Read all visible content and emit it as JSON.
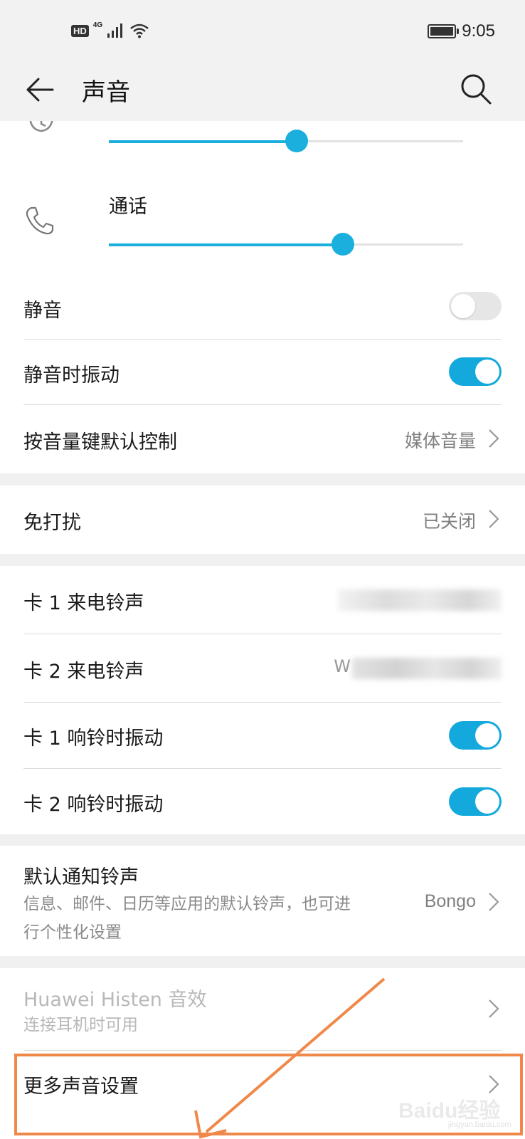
{
  "status": {
    "hd": "HD",
    "network": "4G",
    "time": "9:05"
  },
  "header": {
    "title": "声音"
  },
  "volume": {
    "call_label": "通话",
    "level_top": 0.53,
    "level_call": 0.66
  },
  "settings": {
    "silent": {
      "label": "静音",
      "on": false
    },
    "vibrate_silent": {
      "label": "静音时振动",
      "on": true
    },
    "volume_key": {
      "label": "按音量键默认控制",
      "value": "媒体音量"
    },
    "dnd": {
      "label": "免打扰",
      "value": "已关闭"
    },
    "sim1_ringtone": {
      "label": "卡 1 来电铃声"
    },
    "sim2_ringtone": {
      "label": "卡 2 来电铃声",
      "value_partial": "W"
    },
    "sim1_vibrate": {
      "label": "卡 1 响铃时振动",
      "on": true
    },
    "sim2_vibrate": {
      "label": "卡 2 响铃时振动",
      "on": true
    },
    "notification": {
      "label": "默认通知铃声",
      "desc": "信息、邮件、日历等应用的默认铃声，也可进行个性化设置",
      "value": "Bongo"
    },
    "histen": {
      "label": "Huawei Histen 音效",
      "desc": "连接耳机时可用"
    },
    "more": {
      "label": "更多声音设置"
    }
  },
  "watermark": {
    "main": "Baidu经验",
    "sub": "jingyan.baidu.com"
  },
  "colors": {
    "accent": "#14a9dc",
    "highlight": "#f0884a"
  }
}
